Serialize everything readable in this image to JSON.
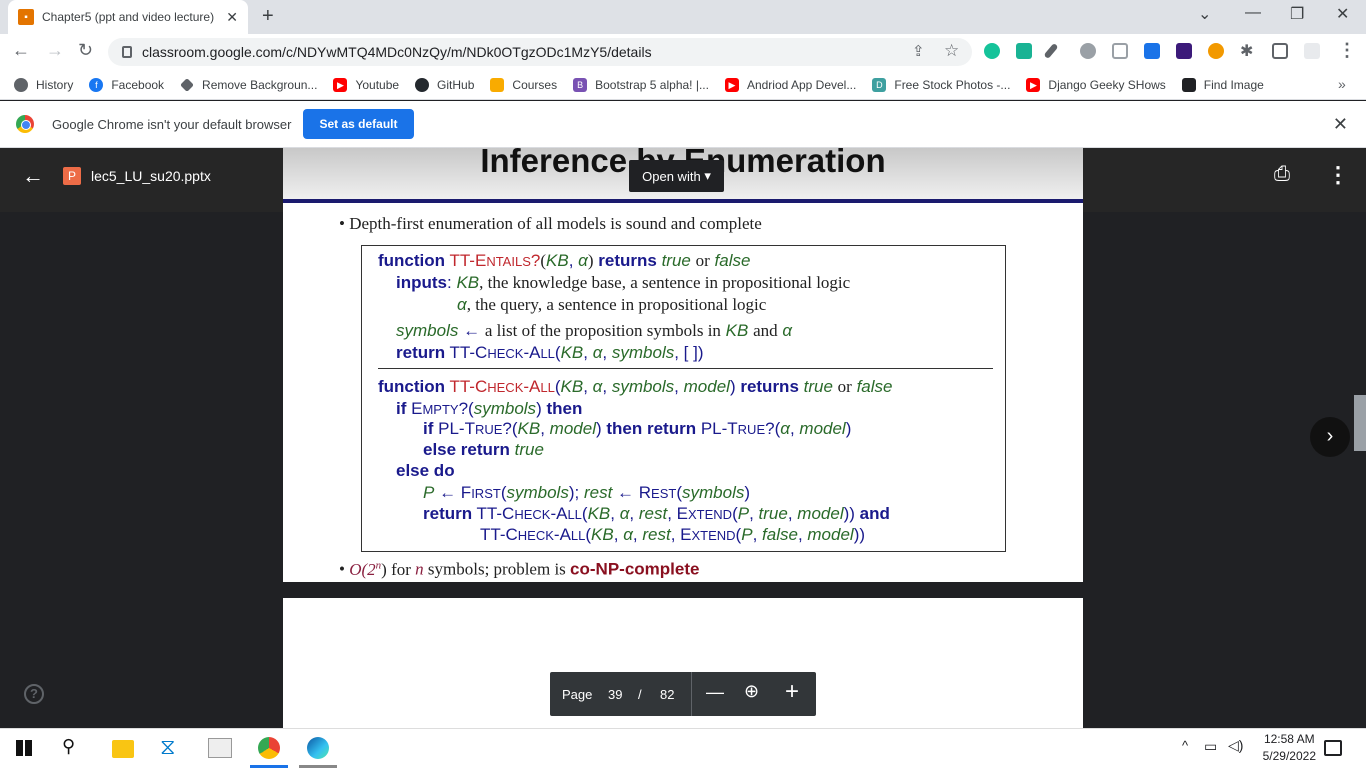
{
  "browser": {
    "tab_title": "Chapter5 (ppt and video lecture)",
    "url": "classroom.google.com/c/NDYwMTQ4MDc0NzQy/m/NDk0OTgzODc1MzY5/details",
    "bookmarks": [
      {
        "label": "History",
        "icon": "history-icon",
        "color": "#5f6368"
      },
      {
        "label": "Facebook",
        "icon": "facebook-icon",
        "color": "#1877f2"
      },
      {
        "label": "Remove Backgroun...",
        "icon": "diamond-icon",
        "color": "#5f6368"
      },
      {
        "label": "Youtube",
        "icon": "youtube-icon",
        "color": "#ff0000"
      },
      {
        "label": "GitHub",
        "icon": "github-icon",
        "color": "#24292e"
      },
      {
        "label": "Courses",
        "icon": "classroom-icon",
        "color": "#f9ab00"
      },
      {
        "label": "Bootstrap 5 alpha! |...",
        "icon": "bootstrap-icon",
        "color": "#7952b3"
      },
      {
        "label": "Andriod App Devel...",
        "icon": "youtube-icon",
        "color": "#ff0000"
      },
      {
        "label": "Free Stock Photos -...",
        "icon": "d-icon",
        "color": "#3ea0a0"
      },
      {
        "label": "Django Geeky SHows",
        "icon": "youtube-icon",
        "color": "#ff0000"
      },
      {
        "label": "Find Image",
        "icon": "find-image-icon",
        "color": "#202124"
      }
    ],
    "infobar_text": "Google Chrome isn't your default browser",
    "set_default_label": "Set as default"
  },
  "viewer": {
    "filename": "lec5_LU_su20.pptx",
    "file_badge": "P",
    "open_with_label": "Open with",
    "page_label": "Page",
    "page_current": "39",
    "page_sep": "/",
    "page_total": "82"
  },
  "slide": {
    "title": "Inference by Enumeration",
    "bullet1": "Depth-first enumeration of all models is sound and complete",
    "bullet2_prefix": "O(2",
    "bullet2_exp": "n",
    "bullet2_mid": ") for ",
    "bullet2_n": "n",
    "bullet2_rest": " symbols; problem is ",
    "bullet2_highlight": "co-NP-complete"
  },
  "taskbar": {
    "time": "12:58 AM",
    "date": "5/29/2022"
  }
}
